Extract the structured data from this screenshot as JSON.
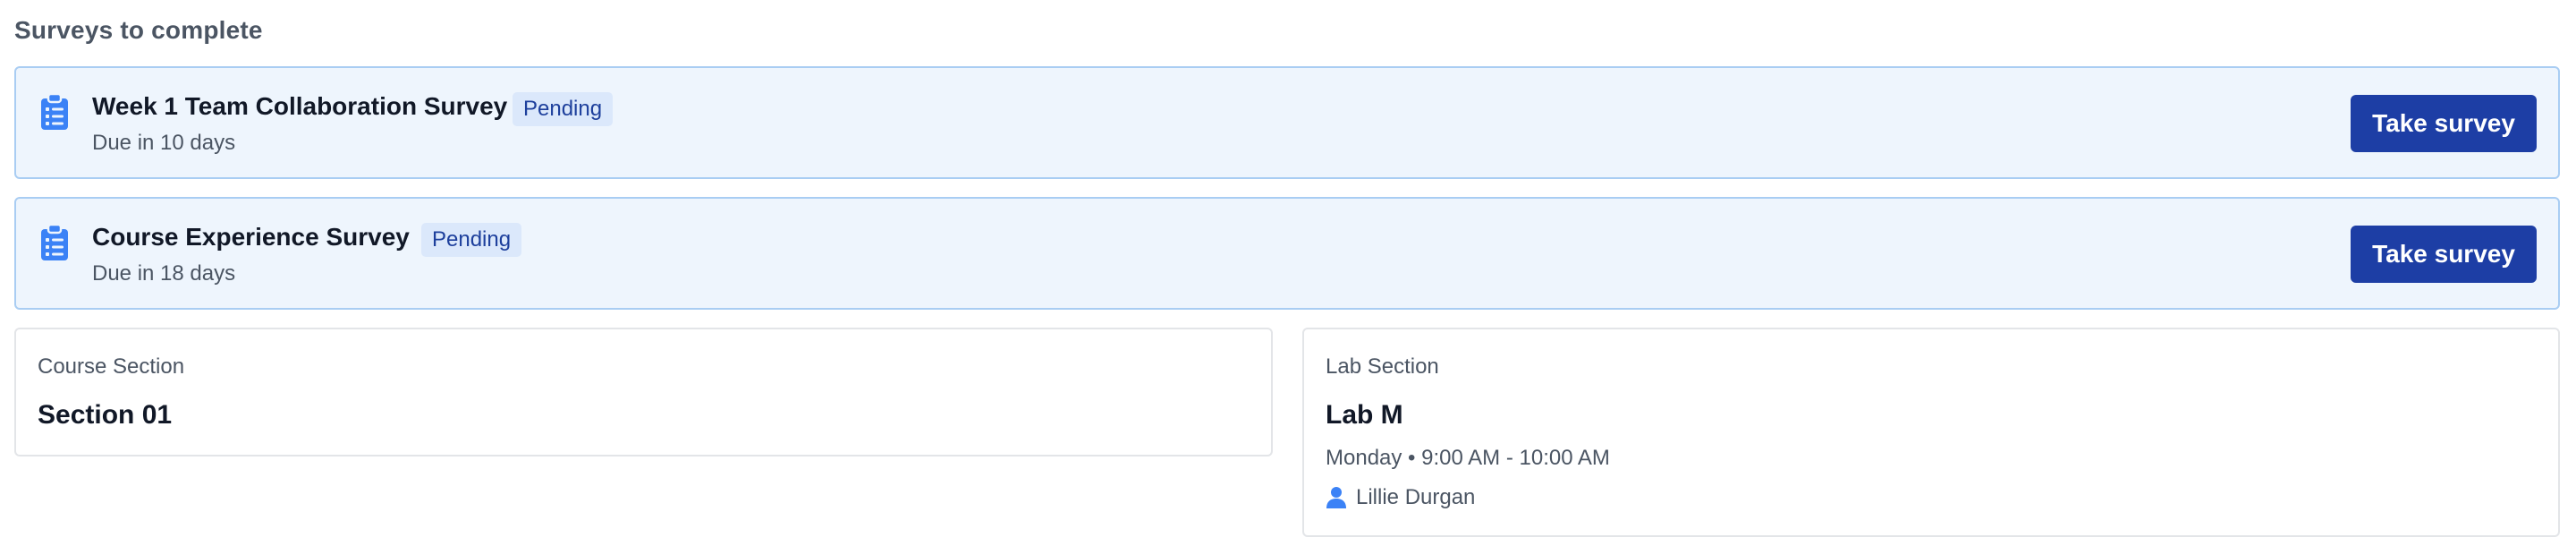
{
  "section": {
    "title": "Surveys to complete"
  },
  "surveys": [
    {
      "title": "Week 1 Team Collaboration Survey",
      "status": "Pending",
      "due": "Due in 10 days",
      "action_label": "Take survey",
      "icon": "clipboard-list-icon"
    },
    {
      "title": "Course Experience Survey",
      "status": "Pending",
      "due": "Due in 18 days",
      "action_label": "Take survey",
      "icon": "clipboard-list-icon"
    }
  ],
  "course_section": {
    "label": "Course Section",
    "value": "Section 01"
  },
  "lab_section": {
    "label": "Lab Section",
    "value": "Lab M",
    "schedule": "Monday • 9:00 AM - 10:00 AM",
    "instructor": "Lillie Durgan",
    "instructor_icon": "person-icon"
  },
  "colors": {
    "accent": "#1d3ea5",
    "card_bg": "#eef5fd",
    "card_border": "#a9cdf3",
    "badge_bg": "#dbe8fb",
    "badge_text": "#1d3f9c",
    "icon_blue": "#3b82f6"
  }
}
